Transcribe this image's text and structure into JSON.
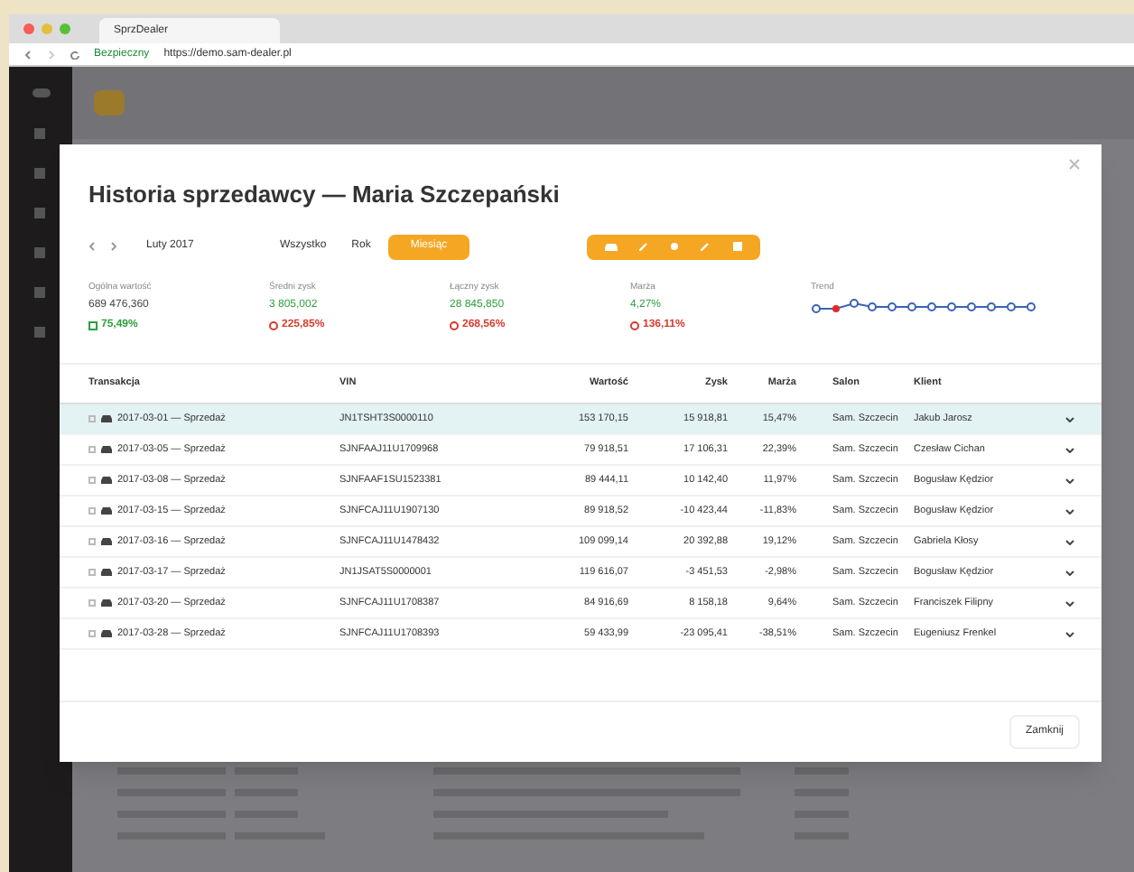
{
  "browser": {
    "tab_title": "SprzDealer",
    "secure_label": "Bezpieczny",
    "url": "https://demo.sam-dealer.pl"
  },
  "modal": {
    "title": "Historia sprzedawcy — Maria Szczepański",
    "period_label": "Luty 2017",
    "close_button": "Zamknij",
    "ranges": [
      {
        "label": "Wszystko",
        "selected": false
      },
      {
        "label": "Rok",
        "selected": false
      },
      {
        "label": "Miesiąc",
        "selected": true
      }
    ],
    "stats": [
      {
        "label": "Ogólna wartość",
        "value": "689 476,360",
        "highlighted": false,
        "change": "75,49%",
        "increase": true
      },
      {
        "label": "Średni zysk",
        "value": "3 805,002",
        "highlighted": true,
        "change": "225,85%",
        "increase": false
      },
      {
        "label": "Łączny zysk",
        "value": "28 845,850",
        "highlighted": true,
        "change": "268,56%",
        "increase": false
      },
      {
        "label": "Marża",
        "value": "4,27%",
        "highlighted": true,
        "change": "136,11%",
        "increase": false
      }
    ],
    "trend_label": "Trend",
    "table": {
      "columns": [
        "Transakcja",
        "VIN",
        "Wartość",
        "Zysk",
        "Marża",
        "Salon",
        "Klient"
      ],
      "rows": [
        {
          "selected": true,
          "cells": [
            "2017-03-01 — Sprzedaż",
            "JN1TSHT3S0000110",
            "153 170,15",
            "15 918,81",
            "15,47%",
            "Sam. Szczecin",
            "Jakub Jarosz"
          ]
        },
        {
          "selected": false,
          "cells": [
            "2017-03-05 — Sprzedaż",
            "SJNFAAJ11U1709968",
            "79 918,51",
            "17 106,31",
            "22,39%",
            "Sam. Szczecin",
            "Czesław Cichan"
          ]
        },
        {
          "selected": false,
          "cells": [
            "2017-03-08 — Sprzedaż",
            "SJNFAAF1SU1523381",
            "89 444,11",
            "10 142,40",
            "11,97%",
            "Sam. Szczecin",
            "Bogusław Kędzior"
          ]
        },
        {
          "selected": false,
          "cells": [
            "2017-03-15 — Sprzedaż",
            "SJNFCAJ11U1907130",
            "89 918,52",
            "-10 423,44",
            "-11,83%",
            "Sam. Szczecin",
            "Bogusław Kędzior"
          ]
        },
        {
          "selected": false,
          "cells": [
            "2017-03-16 — Sprzedaż",
            "SJNFCAJ11U1478432",
            "109 099,14",
            "20 392,88",
            "19,12%",
            "Sam. Szczecin",
            "Gabriela Kłosy"
          ]
        },
        {
          "selected": false,
          "cells": [
            "2017-03-17 — Sprzedaż",
            "JN1JSAT5S0000001",
            "119 616,07",
            "-3 451,53",
            "-2,98%",
            "Sam. Szczecin",
            "Bogusław Kędzior"
          ]
        },
        {
          "selected": false,
          "cells": [
            "2017-03-20 — Sprzedaż",
            "SJNFCAJ11U1708387",
            "84 916,69",
            "8 158,18",
            "9,64%",
            "Sam. Szczecin",
            "Franciszek Filipny"
          ]
        },
        {
          "selected": false,
          "cells": [
            "2017-03-28 — Sprzedaż",
            "SJNFCAJ11U1708393",
            "59 433,99",
            "-23 095,41",
            "-38,51%",
            "Sam. Szczecin",
            "Eugeniusz Frenkel"
          ]
        }
      ]
    }
  }
}
